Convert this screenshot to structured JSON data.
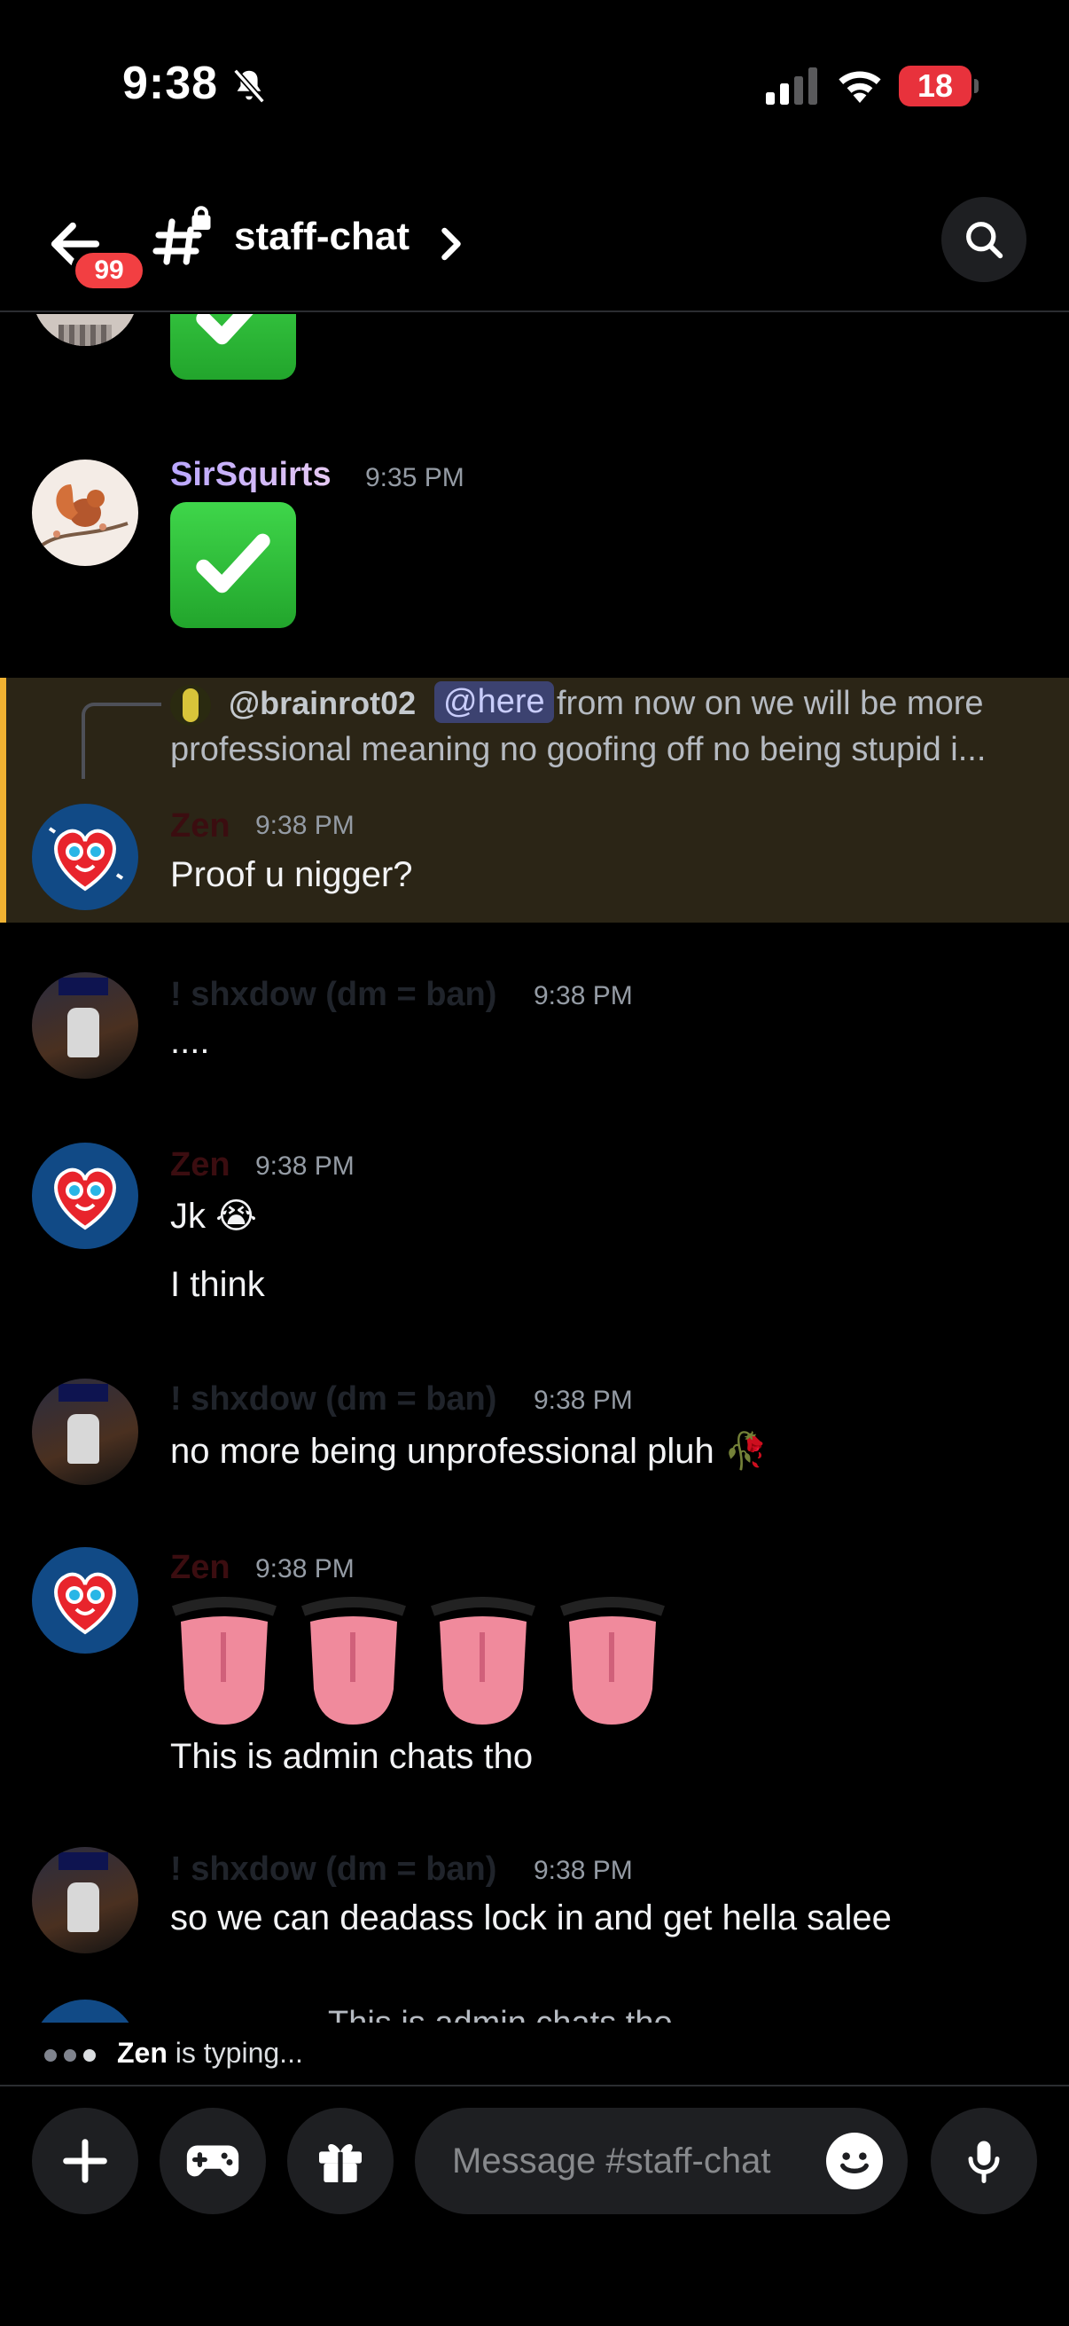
{
  "status_bar": {
    "time": "9:38",
    "battery": "18"
  },
  "header": {
    "badge": "99",
    "channel": "staff-chat"
  },
  "messages": [
    {
      "author": "SirSquirts",
      "time": "9:35 PM",
      "author_color": "#c7b4ff"
    },
    {
      "reply": {
        "author": "@brainrot02",
        "mention": "@here",
        "text1": "from now on we will be more",
        "text2": "professional meaning no goofing off no being stupid i..."
      },
      "author": "Zen",
      "time": "9:38 PM",
      "text": "Proof u nigger?"
    },
    {
      "author": "! shxdow (dm = ban)",
      "time": "9:38 PM",
      "text": "...."
    },
    {
      "author": "Zen",
      "time": "9:38 PM",
      "text": "Jk 😭",
      "text2": "I think"
    },
    {
      "author": "! shxdow (dm = ban)",
      "time": "9:38 PM",
      "text": "no more being unprofessional pluh 🥀"
    },
    {
      "author": "Zen",
      "time": "9:38 PM",
      "text": "This is admin chats tho"
    },
    {
      "author": "! shxdow (dm = ban)",
      "time": "9:38 PM",
      "text": "so we can deadass lock in and get hella salee"
    },
    {
      "partial": "This is admin chats tho"
    }
  ],
  "typing": {
    "user": "Zen",
    "text": "is typing..."
  },
  "composer": {
    "placeholder": "Message #staff-chat"
  },
  "colors": {
    "zen": "#3b0d10",
    "shxdow": "#20242b",
    "highlight": "#f0b232"
  }
}
